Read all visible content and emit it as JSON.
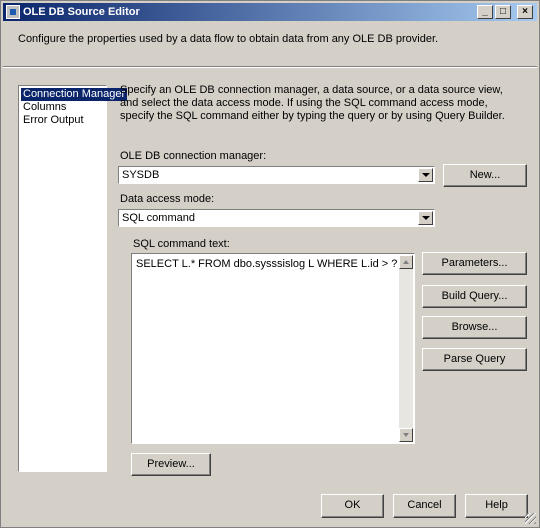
{
  "window": {
    "title": "OLE DB Source Editor",
    "minimize": "_",
    "maximize": "□",
    "close": "×"
  },
  "description": "Configure the properties used by a data flow to obtain data from any OLE DB provider.",
  "nav": {
    "items": [
      {
        "label": "Connection Manager",
        "selected": true
      },
      {
        "label": "Columns",
        "selected": false
      },
      {
        "label": "Error Output",
        "selected": false
      }
    ]
  },
  "info_text": "Specify an OLE DB connection manager, a data source, or a data source view, and select the data access mode. If using the SQL command access mode, specify the SQL command either by typing the query or by using Query Builder.",
  "connection": {
    "label": "OLE DB connection manager:",
    "value": "SYSDB",
    "new_button": "New..."
  },
  "access_mode": {
    "label": "Data access mode:",
    "value": "SQL command"
  },
  "sql": {
    "label": "SQL command text:",
    "text": "SELECT L.* FROM dbo.sysssislog L WHERE L.id > ?"
  },
  "side_buttons": {
    "parameters": "Parameters...",
    "build_query": "Build Query...",
    "browse": "Browse...",
    "parse_query": "Parse Query"
  },
  "preview_button": "Preview...",
  "footer": {
    "ok": "OK",
    "cancel": "Cancel",
    "help": "Help"
  }
}
